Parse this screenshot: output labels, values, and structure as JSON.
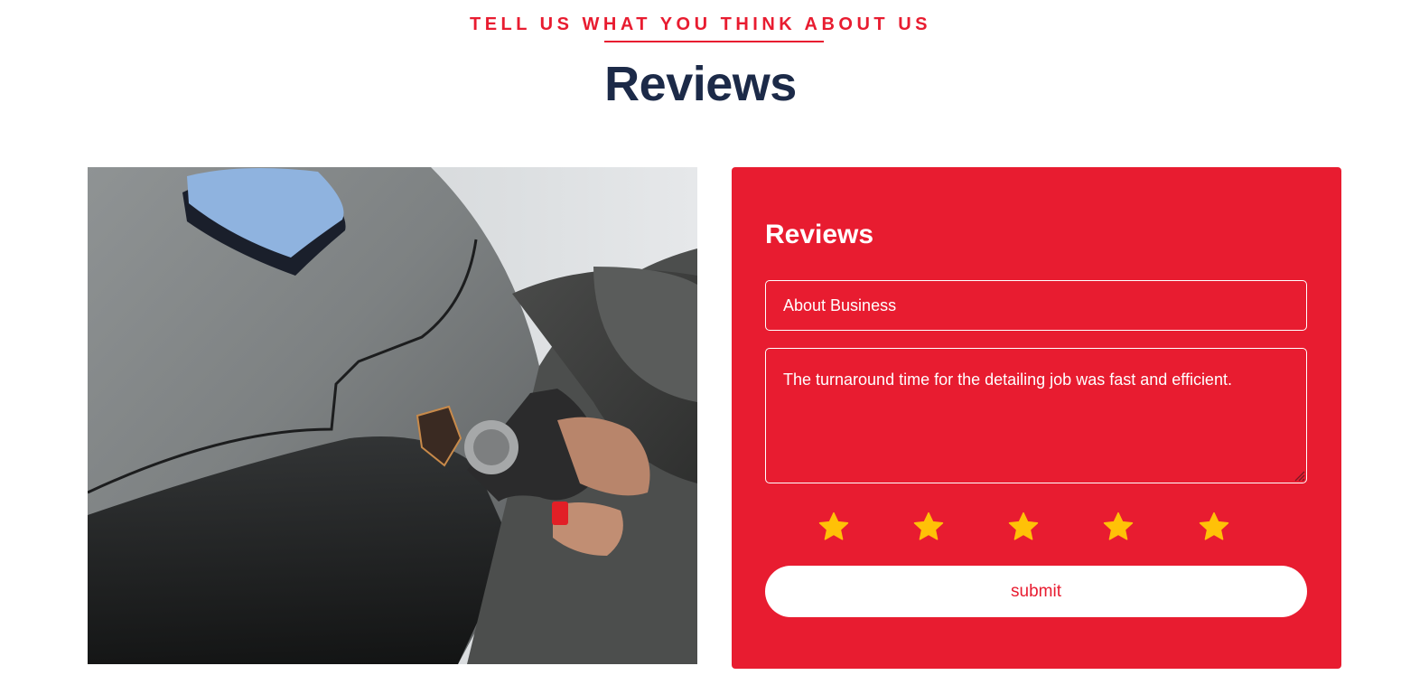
{
  "header": {
    "eyebrow": "TELL US WHAT YOU THINK ABOUT US",
    "title": "Reviews"
  },
  "photo": {
    "alt": "Hand polishing a grey sports car with an orbital buffer"
  },
  "form": {
    "title": "Reviews",
    "subject_value": "About Business",
    "message_value": "The turnaround time for the detailing job was fast and efficient.",
    "rating": 5,
    "rating_max": 5,
    "submit_label": "submit"
  },
  "colors": {
    "accent": "#e81c30",
    "heading": "#1c2a48",
    "star": "#ffc107"
  },
  "icons": {
    "star": "star-icon",
    "resize": "resize-grip-icon"
  }
}
